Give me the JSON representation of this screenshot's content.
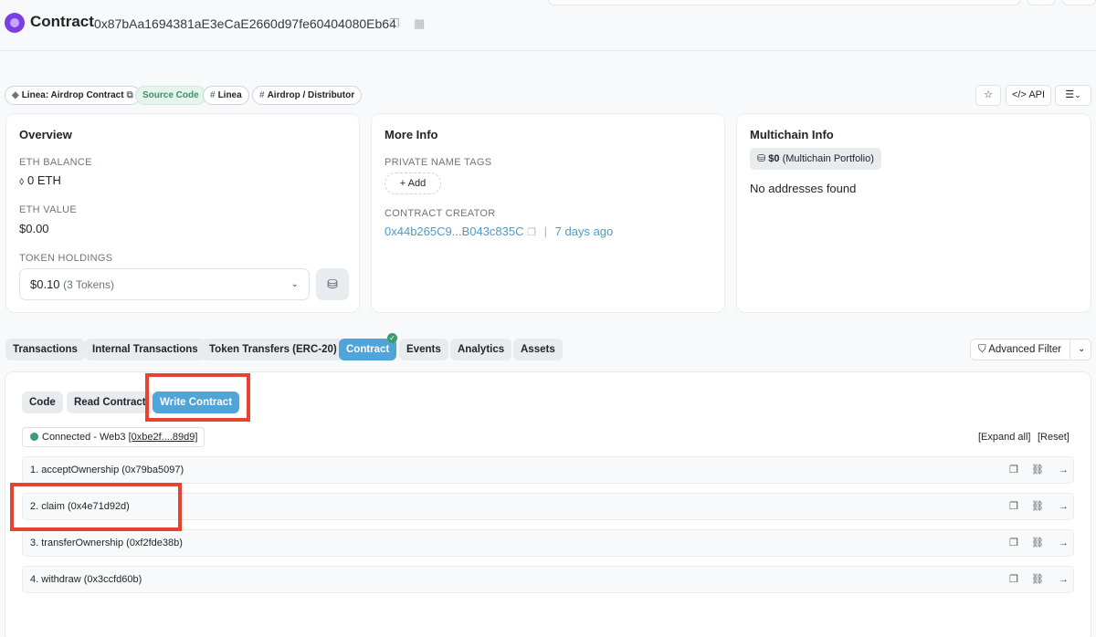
{
  "header": {
    "title": "Contract",
    "address": "0x87bAa1694381aE3eCaE2660d97fe60404080Eb64"
  },
  "tags": [
    {
      "label": "Linea: Airdrop Contract"
    },
    {
      "label": "Source Code"
    },
    {
      "label": "Linea"
    },
    {
      "label": "Airdrop / Distributor"
    }
  ],
  "header_actions": {
    "api_label": "API"
  },
  "overview": {
    "title": "Overview",
    "eth_balance_label": "ETH BALANCE",
    "eth_balance": "0 ETH",
    "eth_value_label": "ETH VALUE",
    "eth_value": "$0.00",
    "token_holdings_label": "TOKEN HOLDINGS",
    "token_value": "$0.10",
    "token_count": "(3 Tokens)"
  },
  "more_info": {
    "title": "More Info",
    "private_tags_label": "PRIVATE NAME TAGS",
    "add_label": "Add",
    "creator_label": "CONTRACT CREATOR",
    "creator_address": "0x44b265C9...B043c835C",
    "separator": "|",
    "creator_time": "7 days ago"
  },
  "multichain": {
    "title": "Multichain Info",
    "portfolio_value": "$0",
    "portfolio_label": "(Multichain Portfolio)",
    "empty_text": "No addresses found"
  },
  "tabs": [
    {
      "label": "Transactions"
    },
    {
      "label": "Internal Transactions"
    },
    {
      "label": "Token Transfers (ERC-20)"
    },
    {
      "label": "Contract"
    },
    {
      "label": "Events"
    },
    {
      "label": "Analytics"
    },
    {
      "label": "Assets"
    }
  ],
  "advanced_filter": "Advanced Filter",
  "subtabs": [
    {
      "label": "Code"
    },
    {
      "label": "Read Contract"
    },
    {
      "label": "Write Contract"
    }
  ],
  "connection": {
    "status": "Connected - Web3",
    "account": "[0xbe2f....89d9]"
  },
  "expand_all": "[Expand all]",
  "reset": "[Reset]",
  "functions": [
    {
      "label": "1. acceptOwnership (0x79ba5097)"
    },
    {
      "label": "2. claim (0x4e71d92d)"
    },
    {
      "label": "3. transferOwnership (0xf2fde38b)"
    },
    {
      "label": "4. withdraw (0x3ccfd60b)"
    }
  ],
  "colors": {
    "accent": "#4fa4d9",
    "success": "#3c9b72",
    "annotation": "#e8432f"
  }
}
